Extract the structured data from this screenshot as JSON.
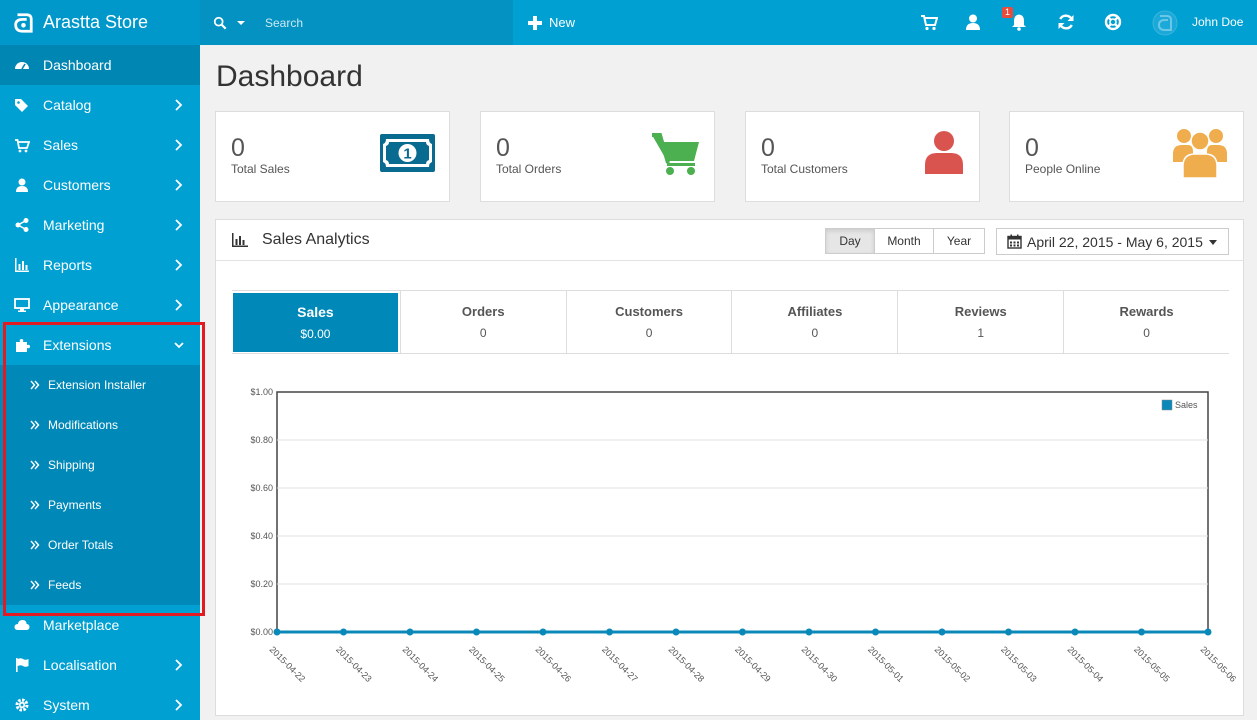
{
  "header": {
    "brand": "Arastta Store",
    "search_placeholder": "Search",
    "new_label": "New",
    "notification_count": "1",
    "user_name": "John Doe"
  },
  "sidebar": {
    "items": [
      {
        "label": "Dashboard",
        "icon": "dashboard-icon"
      },
      {
        "label": "Catalog",
        "icon": "tags-icon"
      },
      {
        "label": "Sales",
        "icon": "cart-icon"
      },
      {
        "label": "Customers",
        "icon": "user-icon"
      },
      {
        "label": "Marketing",
        "icon": "share-icon"
      },
      {
        "label": "Reports",
        "icon": "bar-chart-icon"
      },
      {
        "label": "Appearance",
        "icon": "monitor-icon"
      },
      {
        "label": "Extensions",
        "icon": "puzzle-icon"
      },
      {
        "label": "Marketplace",
        "icon": "cloud-icon"
      },
      {
        "label": "Localisation",
        "icon": "flag-icon"
      },
      {
        "label": "System",
        "icon": "gear-icon"
      }
    ],
    "extensions_sub": [
      "Extension Installer",
      "Modifications",
      "Shipping",
      "Payments",
      "Order Totals",
      "Feeds"
    ]
  },
  "page_title": "Dashboard",
  "stats": [
    {
      "value": "0",
      "label": "Total Sales",
      "icon": "money-icon",
      "color": "#0a6b91"
    },
    {
      "value": "0",
      "label": "Total Orders",
      "icon": "cart-icon",
      "color": "#4caf50"
    },
    {
      "value": "0",
      "label": "Total Customers",
      "icon": "user-icon",
      "color": "#d9534f"
    },
    {
      "value": "0",
      "label": "People Online",
      "icon": "users-icon",
      "color": "#f0ad4e"
    }
  ],
  "analytics": {
    "title": "Sales Analytics",
    "ranges": [
      "Day",
      "Month",
      "Year"
    ],
    "selected_range": "Day",
    "date_range": "April 22, 2015 - May 6, 2015",
    "tabs": [
      {
        "label": "Sales",
        "value": "$0.00"
      },
      {
        "label": "Orders",
        "value": "0"
      },
      {
        "label": "Customers",
        "value": "0"
      },
      {
        "label": "Affiliates",
        "value": "0"
      },
      {
        "label": "Reviews",
        "value": "1"
      },
      {
        "label": "Rewards",
        "value": "0"
      }
    ]
  },
  "chart_data": {
    "type": "line",
    "x": [
      "2015-04-22",
      "2015-04-23",
      "2015-04-24",
      "2015-04-25",
      "2015-04-26",
      "2015-04-27",
      "2015-04-28",
      "2015-04-29",
      "2015-04-30",
      "2015-05-01",
      "2015-05-02",
      "2015-05-03",
      "2015-05-04",
      "2015-05-05",
      "2015-05-06"
    ],
    "series": [
      {
        "name": "Sales",
        "values": [
          0,
          0,
          0,
          0,
          0,
          0,
          0,
          0,
          0,
          0,
          0,
          0,
          0,
          0,
          0
        ]
      }
    ],
    "yticks": [
      "$0.00",
      "$0.20",
      "$0.40",
      "$0.60",
      "$0.80",
      "$1.00"
    ],
    "ylim": [
      0,
      1
    ],
    "legend": "top-right",
    "grid": true,
    "color": "#0a89b8"
  }
}
